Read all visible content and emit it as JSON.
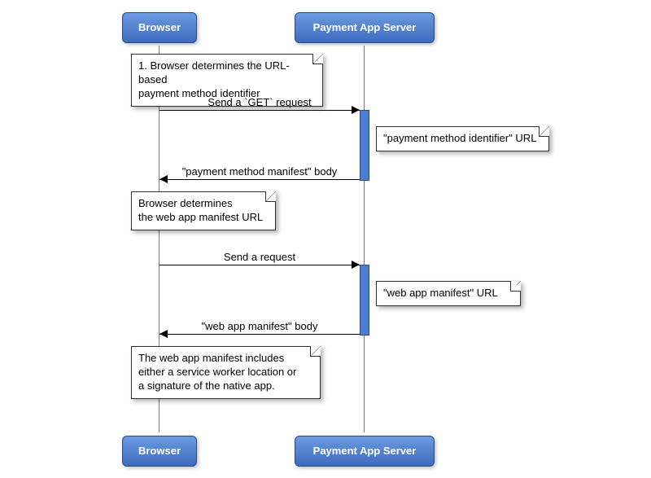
{
  "participants": {
    "browser": "Browser",
    "server": "Payment App Server"
  },
  "messages": {
    "m1": "Send a `GET` request",
    "m2": "\"payment method manifest\" body",
    "m3": "Send a request",
    "m4": "\"web app manifest\" body"
  },
  "notes": {
    "n1_line1": "1. Browser determines the URL-based",
    "n1_line2": "payment method identifier",
    "n2": "\"payment method identifier\" URL",
    "n3_line1": "Browser determines",
    "n3_line2": "the web app manifest URL",
    "n4": "\"web app manifest\" URL",
    "n5_line1": "The web app manifest includes",
    "n5_line2": "either a service worker location or",
    "n5_line3": "a signature of the native app."
  }
}
